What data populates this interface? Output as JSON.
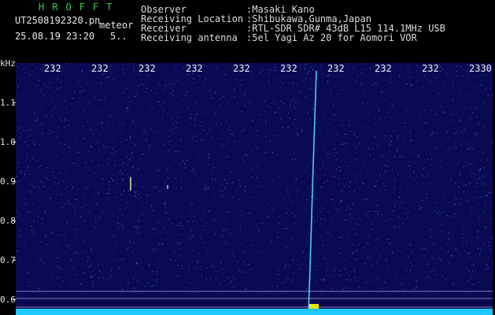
{
  "header": {
    "brand": "HROFFT",
    "filename": "UT2508192320.pn",
    "kind": "meteor",
    "datetime": "25.08.19 23:20",
    "count": "5.."
  },
  "info": [
    {
      "label": "Observer",
      "value": ":Masaki Kano"
    },
    {
      "label": "Receiving Location",
      "value": ":Shibukawa,Gunma,Japan"
    },
    {
      "label": "Receiver",
      "value": ":RTL-SDR SDR# 43dB L15 114.1MHz USB"
    },
    {
      "label": "Receiving antenna",
      "value": ":5el Yagi Az 20 for Aomori VOR"
    }
  ],
  "axis": {
    "unit": "kHz",
    "y_ticks": [
      "1.1",
      "1.0",
      "0.9",
      "0.8",
      "0.7",
      "0.6"
    ],
    "x_ticks": [
      "232",
      "232",
      "232",
      "232",
      "232",
      "232",
      "232",
      "232",
      "232",
      "232",
      "2330"
    ]
  },
  "colors": {
    "background": "#000000",
    "plot_bg": "#0a0a52",
    "brand": "#2fd34a",
    "trace": "#5cf0ff",
    "baseline": "#20c8ff"
  }
}
